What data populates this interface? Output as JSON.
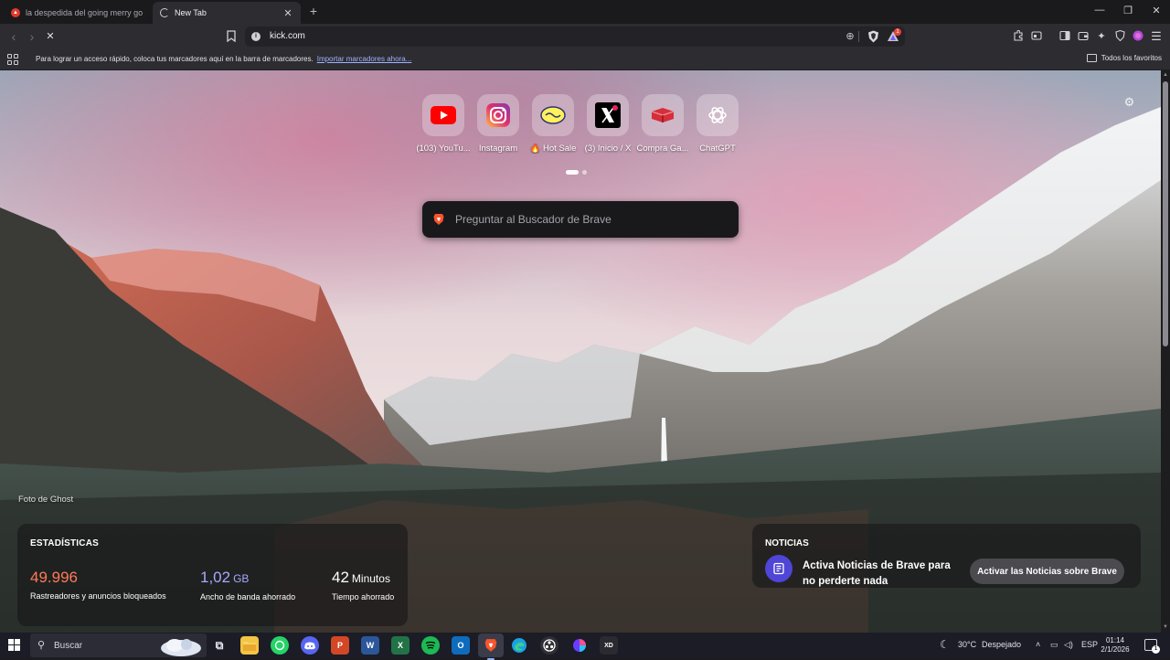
{
  "tabs": [
    {
      "title": "la despedida del going merry go - Br",
      "active": false
    },
    {
      "title": "New Tab",
      "active": true
    }
  ],
  "window_controls": {
    "minimize": "—",
    "restore": "❐",
    "close": "✕"
  },
  "toolbar": {
    "back": "‹",
    "forward": "›",
    "stop": "✕",
    "url": "kick.com",
    "rewards_badge": "1"
  },
  "bookmarks_bar": {
    "message": "Para lograr un acceso rápido, coloca tus marcadores aquí en la barra de marcadores.",
    "import_link": "Importar marcadores ahora...",
    "all_bookmarks": "Todos los favoritos"
  },
  "new_tab": {
    "top_sites": [
      {
        "label": "(103) YouTu...",
        "icon": "youtube-icon"
      },
      {
        "label": "Instagram",
        "icon": "instagram-icon"
      },
      {
        "label": "🔥 Hot Sale",
        "icon": "mercadolibre-icon"
      },
      {
        "label": "(3) Inicio / X",
        "icon": "x-icon"
      },
      {
        "label": "Compra Ga...",
        "icon": "store-icon"
      },
      {
        "label": "ChatGPT",
        "icon": "chatgpt-icon"
      }
    ],
    "search_placeholder": "Preguntar al Buscador de Brave",
    "photo_credit": "Foto de Ghost",
    "stats": {
      "header": "ESTADÍSTICAS",
      "items": [
        {
          "value": "49.996",
          "unit": "",
          "caption": "Rastreadores y anuncios bloqueados",
          "color": "#ff7a59"
        },
        {
          "value": "1,02",
          "unit": "GB",
          "caption": "Ancho de banda ahorrado",
          "color": "#a8a8ff"
        },
        {
          "value": "42",
          "unit": "Minutos",
          "caption": "Tiempo ahorrado",
          "color": "#ffffff"
        }
      ]
    },
    "news": {
      "header": "NOTICIAS",
      "text": "Activa Noticias de Brave para no perderte nada",
      "button": "Activar las Noticias sobre Brave"
    }
  },
  "taskbar": {
    "search_label": "Buscar",
    "apps": [
      "task-view",
      "file-explorer",
      "whatsapp",
      "discord",
      "powerpoint",
      "word",
      "excel",
      "spotify",
      "outlook",
      "brave",
      "edge",
      "obs",
      "color-app",
      "xd-pen"
    ],
    "weather_temp": "30°C",
    "weather_desc": "Despejado",
    "language": "ESP",
    "time": "01:14",
    "date": "2/1/2026",
    "notification_count": "1"
  },
  "colors": {
    "brave_orange": "#fb542b",
    "accent_blue": "#4f45d6",
    "stats_orange": "#ff7a59",
    "stats_purple": "#a8a8ff"
  }
}
